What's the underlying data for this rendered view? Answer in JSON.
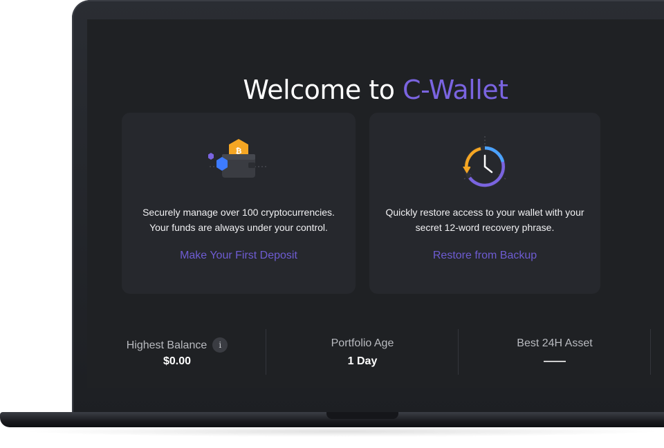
{
  "hero": {
    "title_prefix": "Welcome to ",
    "title_brand": "C-Wallet"
  },
  "cards": [
    {
      "icon": "wallet-crypto-icon",
      "lines": [
        "Securely manage over 100 cryptocurrencies.",
        "Your funds are always under your control."
      ],
      "link": "Make Your First Deposit"
    },
    {
      "icon": "restore-clock-icon",
      "lines": [
        "Quickly restore access to your wallet with your",
        "secret 12-word recovery phrase."
      ],
      "link": "Restore from Backup"
    }
  ],
  "stats": [
    {
      "label": "Highest Balance",
      "value": "$0.00",
      "info_icon": "info-icon",
      "info_glyph": "i"
    },
    {
      "label": "Portfolio Age",
      "value": "1 Day"
    },
    {
      "label": "Best 24H Asset",
      "value": "——"
    }
  ],
  "colors": {
    "accent": "#7a64e0",
    "link": "#6e5cd2",
    "background": "#1f2124",
    "card": "#26282d",
    "bitcoin": "#f5a623"
  }
}
